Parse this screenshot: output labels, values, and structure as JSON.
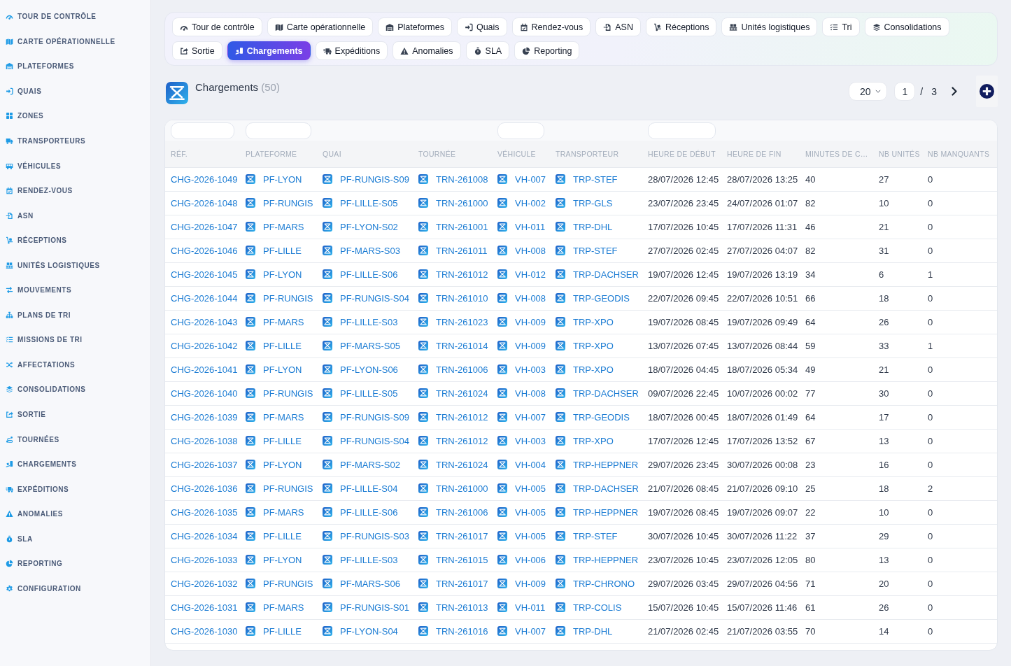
{
  "sidebar": {
    "items": [
      {
        "label": "TOUR DE CONTRÔLE",
        "selected": false
      },
      {
        "label": "CARTE OPÉRATIONNELLE",
        "selected": false
      },
      {
        "label": "PLATEFORMES",
        "selected": false
      },
      {
        "label": "QUAIS",
        "selected": false
      },
      {
        "label": "ZONES",
        "selected": false
      },
      {
        "label": "TRANSPORTEURS",
        "selected": false
      },
      {
        "label": "VÉHICULES",
        "selected": false
      },
      {
        "label": "RENDEZ-VOUS",
        "selected": false
      },
      {
        "label": "ASN",
        "selected": false
      },
      {
        "label": "RÉCEPTIONS",
        "selected": false
      },
      {
        "label": "UNITÉS LOGISTIQUES",
        "selected": false
      },
      {
        "label": "MOUVEMENTS",
        "selected": false
      },
      {
        "label": "PLANS DE TRI",
        "selected": false
      },
      {
        "label": "MISSIONS DE TRI",
        "selected": false
      },
      {
        "label": "AFFECTATIONS",
        "selected": false
      },
      {
        "label": "CONSOLIDATIONS",
        "selected": false
      },
      {
        "label": "SORTIE",
        "selected": false
      },
      {
        "label": "TOURNÉES",
        "selected": false
      },
      {
        "label": "CHARGEMENTS",
        "selected": false
      },
      {
        "label": "EXPÉDITIONS",
        "selected": false
      },
      {
        "label": "ANOMALIES",
        "selected": false
      },
      {
        "label": "SLA",
        "selected": false
      },
      {
        "label": "REPORTING",
        "selected": false
      },
      {
        "label": "CONFIGURATION",
        "selected": false
      }
    ]
  },
  "tabs": [
    {
      "label": "Tour de contrôle",
      "selected": false
    },
    {
      "label": "Carte opérationnelle",
      "selected": false
    },
    {
      "label": "Plateformes",
      "selected": false
    },
    {
      "label": "Quais",
      "selected": false
    },
    {
      "label": "Rendez-vous",
      "selected": false
    },
    {
      "label": "ASN",
      "selected": false
    },
    {
      "label": "Réceptions",
      "selected": false
    },
    {
      "label": "Unités logistiques",
      "selected": false
    },
    {
      "label": "Tri",
      "selected": false
    },
    {
      "label": "Consolidations",
      "selected": false
    },
    {
      "label": "Sortie",
      "selected": false
    },
    {
      "label": "Chargements",
      "selected": true
    },
    {
      "label": "Expéditions",
      "selected": false
    },
    {
      "label": "Anomalies",
      "selected": false
    },
    {
      "label": "SLA",
      "selected": false
    },
    {
      "label": "Reporting",
      "selected": false
    }
  ],
  "page_header": {
    "title": "Chargements",
    "count": "(50)"
  },
  "pagination": {
    "page_size": "20",
    "page": "1",
    "separator": "/",
    "total_pages": "3"
  },
  "table": {
    "columns": [
      {
        "label": "RÉF.",
        "kind": "link",
        "filter": true
      },
      {
        "label": "PLATEFORME",
        "kind": "icon_link",
        "filter": true
      },
      {
        "label": "QUAI",
        "kind": "icon_link",
        "filter": false
      },
      {
        "label": "TOURNÉE",
        "kind": "icon_link",
        "filter": false
      },
      {
        "label": "VÉHICULE",
        "kind": "icon_link",
        "filter": true
      },
      {
        "label": "TRANSPORTEUR",
        "kind": "icon_link",
        "filter": false
      },
      {
        "label": "HEURE DE DÉBUT",
        "kind": "text",
        "filter": true
      },
      {
        "label": "HEURE DE FIN",
        "kind": "text",
        "filter": false
      },
      {
        "label": "MINUTES DE C…",
        "kind": "text",
        "filter": false
      },
      {
        "label": "NB UNITÉS",
        "kind": "text",
        "filter": false
      },
      {
        "label": "NB MANQUANTS",
        "kind": "text",
        "filter": false
      }
    ],
    "rows": [
      [
        "CHG-2026-1049",
        "PF-LYON",
        "PF-RUNGIS-S09",
        "TRN-261008",
        "VH-007",
        "TRP-STEF",
        "28/07/2026 12:45",
        "28/07/2026 13:25",
        "40",
        "27",
        "0"
      ],
      [
        "CHG-2026-1048",
        "PF-RUNGIS",
        "PF-LILLE-S05",
        "TRN-261000",
        "VH-002",
        "TRP-GLS",
        "23/07/2026 23:45",
        "24/07/2026 01:07",
        "82",
        "10",
        "0"
      ],
      [
        "CHG-2026-1047",
        "PF-MARS",
        "PF-LYON-S02",
        "TRN-261001",
        "VH-011",
        "TRP-DHL",
        "17/07/2026 10:45",
        "17/07/2026 11:31",
        "46",
        "21",
        "0"
      ],
      [
        "CHG-2026-1046",
        "PF-LILLE",
        "PF-MARS-S03",
        "TRN-261011",
        "VH-008",
        "TRP-STEF",
        "27/07/2026 02:45",
        "27/07/2026 04:07",
        "82",
        "31",
        "0"
      ],
      [
        "CHG-2026-1045",
        "PF-LYON",
        "PF-LILLE-S06",
        "TRN-261012",
        "VH-012",
        "TRP-DACHSER",
        "19/07/2026 12:45",
        "19/07/2026 13:19",
        "34",
        "6",
        "1"
      ],
      [
        "CHG-2026-1044",
        "PF-RUNGIS",
        "PF-RUNGIS-S04",
        "TRN-261010",
        "VH-008",
        "TRP-GEODIS",
        "22/07/2026 09:45",
        "22/07/2026 10:51",
        "66",
        "18",
        "0"
      ],
      [
        "CHG-2026-1043",
        "PF-MARS",
        "PF-LILLE-S03",
        "TRN-261023",
        "VH-009",
        "TRP-XPO",
        "19/07/2026 08:45",
        "19/07/2026 09:49",
        "64",
        "26",
        "0"
      ],
      [
        "CHG-2026-1042",
        "PF-LILLE",
        "PF-MARS-S05",
        "TRN-261014",
        "VH-009",
        "TRP-XPO",
        "13/07/2026 07:45",
        "13/07/2026 08:44",
        "59",
        "33",
        "1"
      ],
      [
        "CHG-2026-1041",
        "PF-LYON",
        "PF-LYON-S06",
        "TRN-261006",
        "VH-003",
        "TRP-XPO",
        "18/07/2026 04:45",
        "18/07/2026 05:34",
        "49",
        "21",
        "0"
      ],
      [
        "CHG-2026-1040",
        "PF-RUNGIS",
        "PF-LILLE-S05",
        "TRN-261024",
        "VH-008",
        "TRP-DACHSER",
        "09/07/2026 22:45",
        "10/07/2026 00:02",
        "77",
        "30",
        "0"
      ],
      [
        "CHG-2026-1039",
        "PF-MARS",
        "PF-RUNGIS-S09",
        "TRN-261012",
        "VH-007",
        "TRP-GEODIS",
        "18/07/2026 00:45",
        "18/07/2026 01:49",
        "64",
        "17",
        "0"
      ],
      [
        "CHG-2026-1038",
        "PF-LILLE",
        "PF-RUNGIS-S04",
        "TRN-261012",
        "VH-003",
        "TRP-XPO",
        "17/07/2026 12:45",
        "17/07/2026 13:52",
        "67",
        "13",
        "0"
      ],
      [
        "CHG-2026-1037",
        "PF-LYON",
        "PF-MARS-S02",
        "TRN-261024",
        "VH-004",
        "TRP-HEPPNER",
        "29/07/2026 23:45",
        "30/07/2026 00:08",
        "23",
        "16",
        "0"
      ],
      [
        "CHG-2026-1036",
        "PF-RUNGIS",
        "PF-LILLE-S04",
        "TRN-261000",
        "VH-005",
        "TRP-DACHSER",
        "21/07/2026 08:45",
        "21/07/2026 09:10",
        "25",
        "18",
        "2"
      ],
      [
        "CHG-2026-1035",
        "PF-MARS",
        "PF-LILLE-S06",
        "TRN-261006",
        "VH-005",
        "TRP-HEPPNER",
        "19/07/2026 08:45",
        "19/07/2026 09:07",
        "22",
        "10",
        "0"
      ],
      [
        "CHG-2026-1034",
        "PF-LILLE",
        "PF-RUNGIS-S03",
        "TRN-261017",
        "VH-005",
        "TRP-STEF",
        "30/07/2026 10:45",
        "30/07/2026 11:22",
        "37",
        "29",
        "0"
      ],
      [
        "CHG-2026-1033",
        "PF-LYON",
        "PF-LILLE-S03",
        "TRN-261015",
        "VH-006",
        "TRP-HEPPNER",
        "23/07/2026 10:45",
        "23/07/2026 12:05",
        "80",
        "13",
        "0"
      ],
      [
        "CHG-2026-1032",
        "PF-RUNGIS",
        "PF-MARS-S06",
        "TRN-261017",
        "VH-009",
        "TRP-CHRONO",
        "29/07/2026 03:45",
        "29/07/2026 04:56",
        "71",
        "20",
        "0"
      ],
      [
        "CHG-2026-1031",
        "PF-MARS",
        "PF-RUNGIS-S01",
        "TRN-261013",
        "VH-011",
        "TRP-COLIS",
        "15/07/2026 10:45",
        "15/07/2026 11:46",
        "61",
        "26",
        "0"
      ],
      [
        "CHG-2026-1030",
        "PF-LILLE",
        "PF-LYON-S04",
        "TRN-261016",
        "VH-007",
        "TRP-DHL",
        "21/07/2026 02:45",
        "21/07/2026 03:55",
        "70",
        "14",
        "0"
      ]
    ]
  }
}
